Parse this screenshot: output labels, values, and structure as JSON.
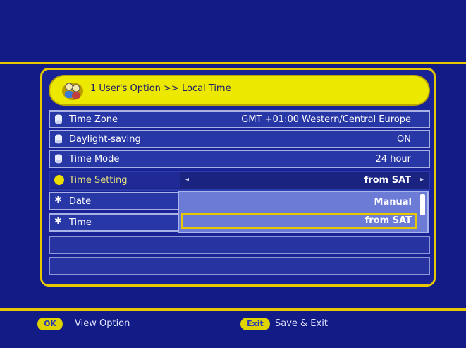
{
  "header": {
    "title": "1  User's Option >> Local Time"
  },
  "rows": [
    {
      "label": "Time Zone",
      "value": "GMT +01:00 Western/Central Europe"
    },
    {
      "label": "Daylight-saving",
      "value": "ON"
    },
    {
      "label": "Time Mode",
      "value": "24 hour"
    },
    {
      "label": "Time Setting",
      "value": "from SAT"
    },
    {
      "label": "Date",
      "value": ""
    },
    {
      "label": "Time",
      "value": ""
    }
  ],
  "dropdown": {
    "options": [
      "Manual",
      "from SAT"
    ],
    "selected": "from SAT"
  },
  "footer": {
    "ok_key": "OK",
    "ok_label": "View Option",
    "exit_key": "Exit",
    "exit_label": "Save & Exit"
  },
  "colors": {
    "background": "#131b86",
    "accent": "#e6c800",
    "header": "#ece800"
  }
}
